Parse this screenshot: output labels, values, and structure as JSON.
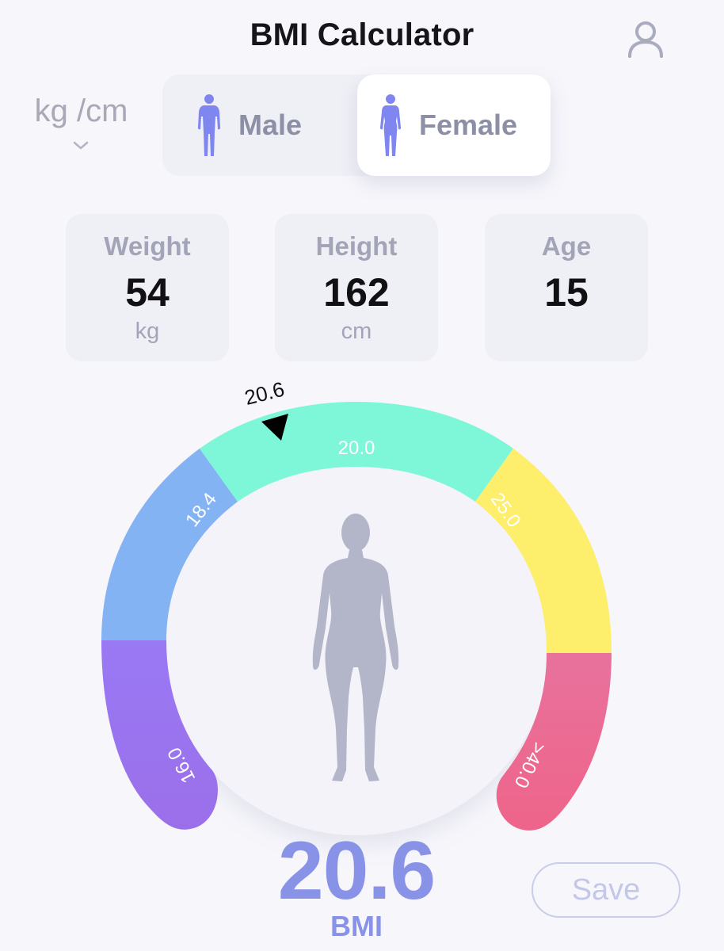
{
  "header": {
    "title": "BMI Calculator",
    "profile_icon": "user-icon"
  },
  "units": {
    "label": "kg /cm",
    "chevron_icon": "chevron-down-icon"
  },
  "gender": {
    "options": [
      {
        "label": "Male",
        "icon": "male-figure-icon",
        "selected": false
      },
      {
        "label": "Female",
        "icon": "female-figure-icon",
        "selected": true
      }
    ],
    "icon_color": "#7f86f0"
  },
  "stats": [
    {
      "label": "Weight",
      "value": "54",
      "unit": "kg"
    },
    {
      "label": "Height",
      "value": "162",
      "unit": "cm"
    },
    {
      "label": "Age",
      "value": "15",
      "unit": ""
    }
  ],
  "gauge": {
    "segments": [
      {
        "label": "16.0",
        "color_start": "#9a79f5",
        "color_end": "#9b6fe9"
      },
      {
        "label": "18.4",
        "color_start": "#84b3f4",
        "color_end": "#7fb0f2"
      },
      {
        "label": "20.0",
        "color_start": "#7ef7d8",
        "color_end": "#7ef7d8"
      },
      {
        "label": "25.0",
        "color_start": "#fdee6c",
        "color_end": "#fcec66"
      },
      {
        "label": ">40.0",
        "color_start": "#e8729c",
        "color_end": "#ee648a"
      }
    ],
    "indicator_label": "20.6",
    "body_figure_color": "#b3b5c8",
    "center_figure_icon": "female-body-silhouette-icon"
  },
  "result": {
    "value": "20.6",
    "unit": "BMI"
  },
  "actions": {
    "save_label": "Save"
  }
}
